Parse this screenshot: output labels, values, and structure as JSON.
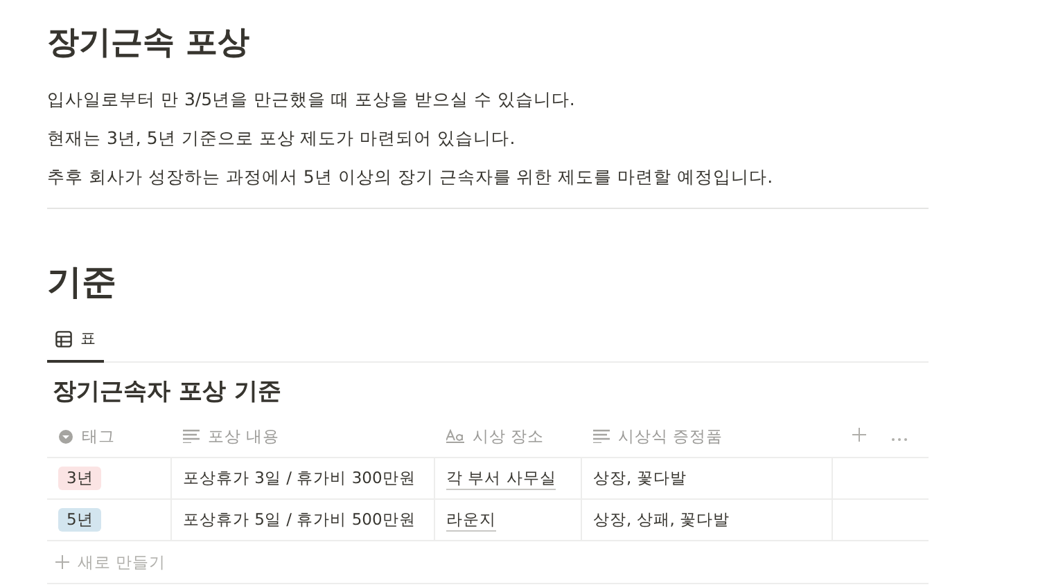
{
  "page_title": "장기근속 포상",
  "paragraphs": [
    "입사일로부터 만 3/5년을 만근했을 때 포상을 받으실 수 있습니다.",
    "현재는 3년, 5년 기준으로 포상 제도가 마련되어 있습니다.",
    "추후 회사가 성장하는 과정에서 5년 이상의 장기 근속자를 위한 제도를 마련할 예정입니다."
  ],
  "section_heading": "기준",
  "view_tabs": [
    {
      "label": "표",
      "selected": true
    }
  ],
  "table": {
    "title": "장기근속자 포상 기준",
    "columns": [
      {
        "label": "태그",
        "kind": "select"
      },
      {
        "label": "포상 내용",
        "kind": "text"
      },
      {
        "label": "시상 장소",
        "kind": "title"
      },
      {
        "label": "시상식 증정품",
        "kind": "text"
      }
    ],
    "rows": [
      {
        "tag": {
          "label": "3년",
          "color": "#fbe4e4"
        },
        "content": "포상휴가 3일 / 휴가비 300만원",
        "place": "각 부서 사무실",
        "gifts": "상장, 꽃다발"
      },
      {
        "tag": {
          "label": "5년",
          "color": "#d3e5ef"
        },
        "content": "포상휴가 5일 / 휴가비 500만원",
        "place": "라운지",
        "gifts": "상장, 상패, 꽃다발"
      }
    ],
    "new_row_label": "새로 만들기"
  }
}
